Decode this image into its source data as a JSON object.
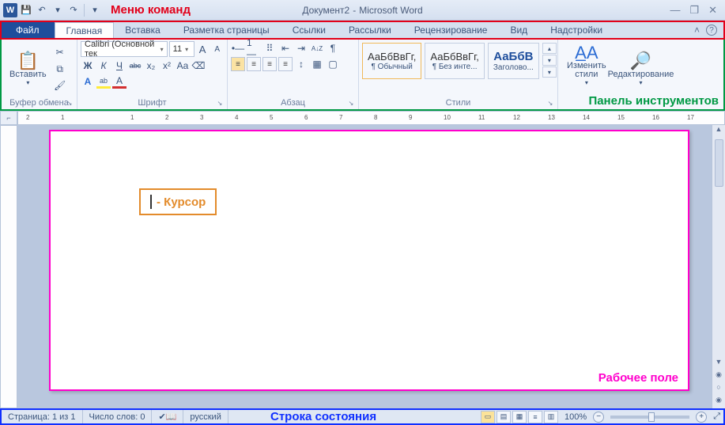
{
  "annotations": {
    "menu": "Меню команд",
    "tools": "Панель инструментов",
    "work": "Рабочее поле",
    "status": "Строка состояния",
    "cursor": "- Курсор"
  },
  "title": {
    "doc": "Документ2",
    "sep": "-",
    "app": "Microsoft Word"
  },
  "qat": {
    "word": "W",
    "save": "💾",
    "undo": "↶",
    "redo": "↷",
    "dd": "▾",
    "more": "▾"
  },
  "win": {
    "min": "—",
    "max": "❐",
    "close": "✕"
  },
  "tabs": {
    "file": "Файл",
    "home": "Главная",
    "insert": "Вставка",
    "layout": "Разметка страницы",
    "refs": "Ссылки",
    "mail": "Рассылки",
    "review": "Рецензирование",
    "view": "Вид",
    "addin": "Надстройки",
    "help": "?",
    "collapse": "˄"
  },
  "ribbon": {
    "clipboard": {
      "paste": "Вставить",
      "label": "Буфер обмена"
    },
    "font": {
      "name": "Calibri (Основной тек",
      "size": "11",
      "label": "Шрифт",
      "bold": "Ж",
      "italic": "К",
      "under": "Ч",
      "strike": "abc",
      "sub": "x₂",
      "sup": "x²",
      "case": "Aa",
      "clear": "⌫",
      "grow": "A",
      "shrink": "A",
      "highlight": "ab",
      "color": "A"
    },
    "para": {
      "label": "Абзац",
      "bullets": "•—",
      "numbers": "1—",
      "multi": "⠿",
      "indentL": "⇤",
      "indentR": "⇥",
      "sort": "A↓Z",
      "marks": "¶",
      "alignL": "≡",
      "alignC": "≡",
      "alignR": "≡",
      "justify": "≡",
      "spacing": "↕",
      "shade": "▦",
      "border": "▢"
    },
    "styles": {
      "label": "Стили",
      "s1": {
        "sample": "АаБбВвГг,",
        "name": "¶ Обычный"
      },
      "s2": {
        "sample": "АаБбВвГг,",
        "name": "¶ Без инте..."
      },
      "s3": {
        "sample": "АаБбВ",
        "name": "Заголово..."
      },
      "change": "Изменить стили"
    },
    "edit": {
      "label": "Редактирование",
      "find": "🔎"
    }
  },
  "ruler_corner": "⌐",
  "status": {
    "page": "Страница: 1 из 1",
    "words": "Число слов: 0",
    "lang": "русский",
    "zoom": "100%",
    "minus": "−",
    "plus": "+",
    "expand": "⤢"
  }
}
